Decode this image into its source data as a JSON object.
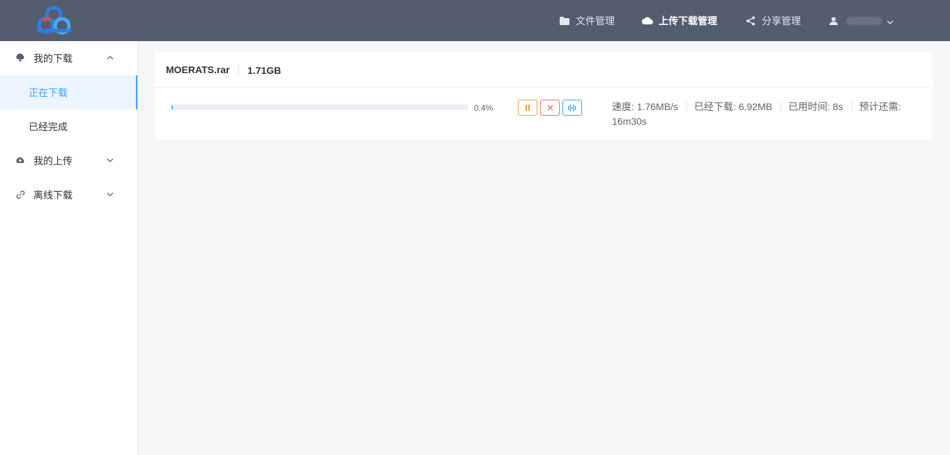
{
  "header": {
    "nav": [
      {
        "label": "文件管理",
        "icon": "folder-icon"
      },
      {
        "label": "上传下载管理",
        "icon": "cloud-icon",
        "active": true
      },
      {
        "label": "分享管理",
        "icon": "share-icon"
      }
    ],
    "user": {
      "icon": "user-icon"
    }
  },
  "sidebar": {
    "groups": [
      {
        "label": "我的下载",
        "icon": "cloud-download-icon",
        "expanded": true,
        "items": [
          {
            "label": "正在下载",
            "active": true
          },
          {
            "label": "已经完成"
          }
        ]
      },
      {
        "label": "我的上传",
        "icon": "cloud-upload-icon",
        "expanded": false
      },
      {
        "label": "离线下载",
        "icon": "link-icon",
        "expanded": false
      }
    ]
  },
  "download": {
    "filename": "MOERATS.rar",
    "size": "1.71GB",
    "progress_percent": 0.4,
    "progress_label": "0.4%",
    "speed": "速度: 1.76MB/s",
    "downloaded": "已经下载: 6.92MB",
    "elapsed": "已用时间: 8s",
    "remaining": "预计还需: 16m30s"
  },
  "colors": {
    "header_bg": "#545c70",
    "accent": "#409eff",
    "pause": "#e6a23c",
    "cancel": "#f56c6c"
  }
}
